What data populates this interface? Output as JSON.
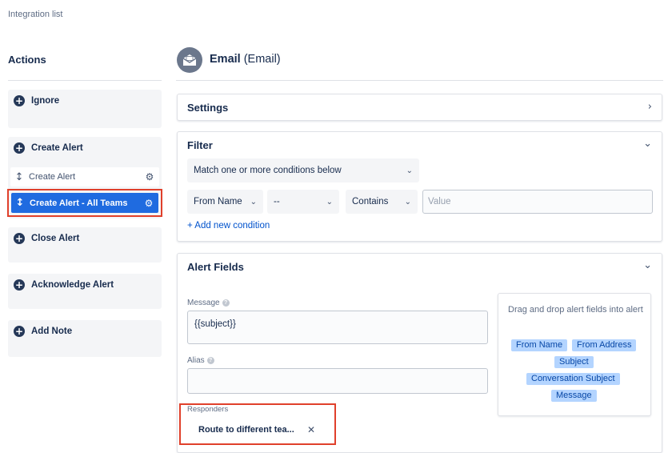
{
  "breadcrumb": "Integration list",
  "actions": {
    "title": "Actions",
    "items": [
      {
        "label": "Ignore"
      },
      {
        "label": "Create Alert"
      },
      {
        "label": "Close Alert"
      },
      {
        "label": "Acknowledge Alert"
      },
      {
        "label": "Add Note"
      }
    ],
    "create_alert_rules": [
      {
        "label": "Create Alert",
        "selected": false
      },
      {
        "label": "Create Alert - All Teams",
        "selected": true
      }
    ]
  },
  "header": {
    "title": "Email",
    "subtitle": "(Email)"
  },
  "settings": {
    "title": "Settings"
  },
  "filter": {
    "title": "Filter",
    "match_select": "Match one or more conditions below",
    "condition": {
      "field": "From Name",
      "negate": "--",
      "operator": "Contains",
      "value_placeholder": "Value"
    },
    "add_condition": "+ Add new condition"
  },
  "alert_fields": {
    "title": "Alert Fields",
    "message_label": "Message",
    "message_value": "{{subject}}",
    "alias_label": "Alias",
    "alias_value": "",
    "responders_label": "Responders",
    "responder_chip": "Route to different tea...",
    "dnd_hint": "Drag and drop alert fields into alert",
    "tags": [
      "From Name",
      "From Address",
      "Subject",
      "Conversation Subject",
      "Message"
    ]
  },
  "colors": {
    "selected_blue": "#1f6be0",
    "highlight_red": "#e0402b",
    "tag_bg": "#b3d4ff",
    "link": "#0052cc"
  }
}
